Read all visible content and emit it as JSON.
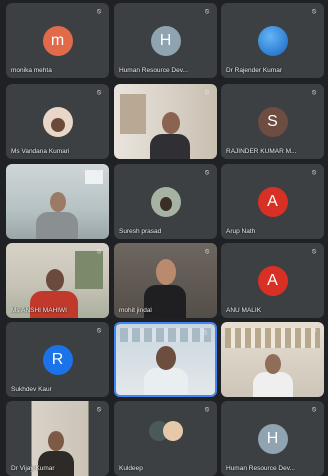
{
  "tiles": [
    {
      "name": "monika mehta",
      "avatar_letter": "m",
      "color": "#e06a4a"
    },
    {
      "name": "Human Resource Dev...",
      "avatar_letter": "H",
      "color": "#8fa3b0"
    },
    {
      "name": "Dr Rajender Kumar",
      "avatar_letter": "",
      "color": "#1e88e5"
    },
    {
      "name": "Ms Vandana Kumari",
      "avatar_letter": "",
      "color": "#d8c2b0"
    },
    {
      "name": "",
      "avatar_letter": "",
      "color": "#6a5a4a"
    },
    {
      "name": "RAJINDER KUMAR M...",
      "avatar_letter": "S",
      "color": "#6d4c41"
    },
    {
      "name": "",
      "avatar_letter": "",
      "color": "#8a9aa0"
    },
    {
      "name": "Suresh prasad",
      "avatar_letter": "",
      "color": "#6e7a6a"
    },
    {
      "name": "Arup Nath",
      "avatar_letter": "A",
      "color": "#d93025"
    },
    {
      "name": "Ms ANSHI MAHIWI",
      "avatar_letter": "",
      "color": "#5a6a5a"
    },
    {
      "name": "mohit jindal",
      "avatar_letter": "",
      "color": "#3a3430"
    },
    {
      "name": "ANU MALIK",
      "avatar_letter": "A",
      "color": "#d93025"
    },
    {
      "name": "Sukhdev Kaur",
      "avatar_letter": "R",
      "color": "#1a73e8"
    },
    {
      "name": "",
      "avatar_letter": "",
      "color": "#c9d6df"
    },
    {
      "name": "",
      "avatar_letter": "",
      "color": "#d8d0c4"
    },
    {
      "name": "Dr Vijay Kumar",
      "avatar_letter": "",
      "color": "#7d7060"
    },
    {
      "name": "Kuldeep",
      "avatar_letter": "",
      "color": "#3c4043"
    },
    {
      "name": "Human Resource Dev...",
      "avatar_letter": "H",
      "color": "#8fa3b0"
    }
  ],
  "mic_icon": "mic-off-icon"
}
